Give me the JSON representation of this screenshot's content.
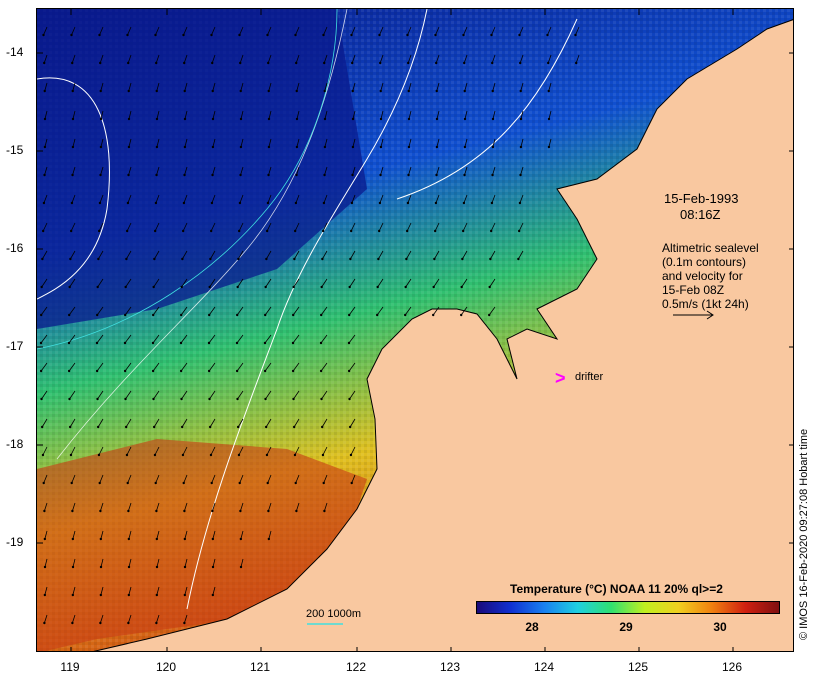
{
  "map": {
    "lat_labels": [
      "-14",
      "-15",
      "-16",
      "-17",
      "-18",
      "-19"
    ],
    "lon_labels": [
      "119",
      "120",
      "121",
      "122",
      "123",
      "124",
      "125",
      "126"
    ],
    "land_color": "#f9c8a0",
    "ocean_cool_color": "#0a1a8c",
    "ocean_warm_color": "#d0401a"
  },
  "annotation": {
    "date": "15-Feb-1993",
    "time": "08:16Z",
    "lines": [
      "Altimetric sealevel",
      "(0.1m contours)",
      "and velocity for",
      "15-Feb 08Z",
      "0.5m/s (1kt 24h)"
    ]
  },
  "colorbar": {
    "title": "Temperature (°C) NOAA 11 20% ql>=2",
    "ticks": [
      "28",
      "29",
      "30"
    ]
  },
  "scale": {
    "label": "200  1000m",
    "line_color": "#40e0e0"
  },
  "drifter": {
    "symbol": ">",
    "label": "drifter",
    "color": "#ff00ff"
  },
  "credit": "© IMOS 16-Feb-2020 09:27:08 Hobart time"
}
